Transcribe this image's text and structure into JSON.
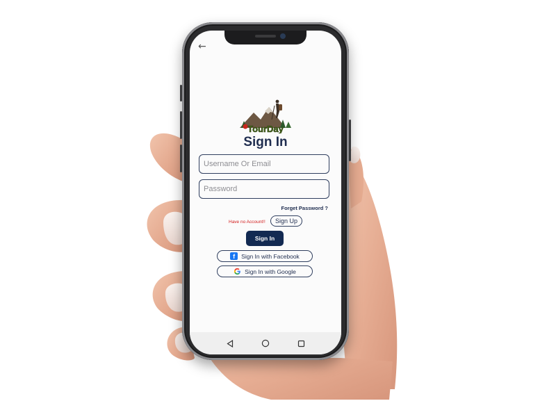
{
  "logo": {
    "text": "TourDay"
  },
  "page_title": "Sign In",
  "username_field": {
    "placeholder": "Username Or Email",
    "value": ""
  },
  "password_field": {
    "placeholder": "Password",
    "value": ""
  },
  "forget_password": "Forget Password ?",
  "no_account": "Have no Account!!",
  "signup_button": "Sign Up",
  "signin_button": "Sign In",
  "facebook_button": "Sign In with Facebook",
  "google_button": "Sign In with Google",
  "icons": {
    "back": "back-arrow-icon",
    "facebook": "facebook-icon",
    "google": "google-icon",
    "nav_back": "triangle-back-icon",
    "nav_home": "circle-home-icon",
    "nav_recents": "square-recents-icon"
  },
  "colors": {
    "primary": "#132a52",
    "accent_text": "#1f2d4f",
    "warning": "#d21d1d",
    "facebook_blue": "#1877f2"
  }
}
